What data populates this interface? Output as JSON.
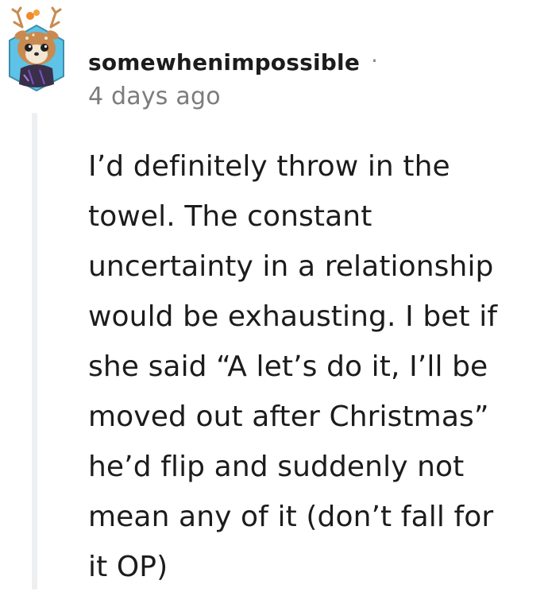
{
  "comment": {
    "author": "somewhenimpossible",
    "separator": "·",
    "timestamp": "4 days ago",
    "lines": [
      "I’d definitely throw in the",
      "towel. The constant",
      "uncertainty in a relationship",
      "would be exhausting. I bet if",
      "she said “A let’s do it, I’ll be",
      "moved out after Christmas”",
      "he’d flip and suddenly not",
      "mean any of it (don’t fall for",
      "it OP)"
    ]
  },
  "colors": {
    "text": "#1c1c1c",
    "muted": "#7c7c7c",
    "thread_line": "#edeff1",
    "avatar_hex_bg": "#5ec3e6",
    "avatar_fur": "#c88a50",
    "avatar_outfit": "#3a2f4a"
  },
  "icons": {
    "avatar": "snoo-deer-avatar-icon"
  }
}
